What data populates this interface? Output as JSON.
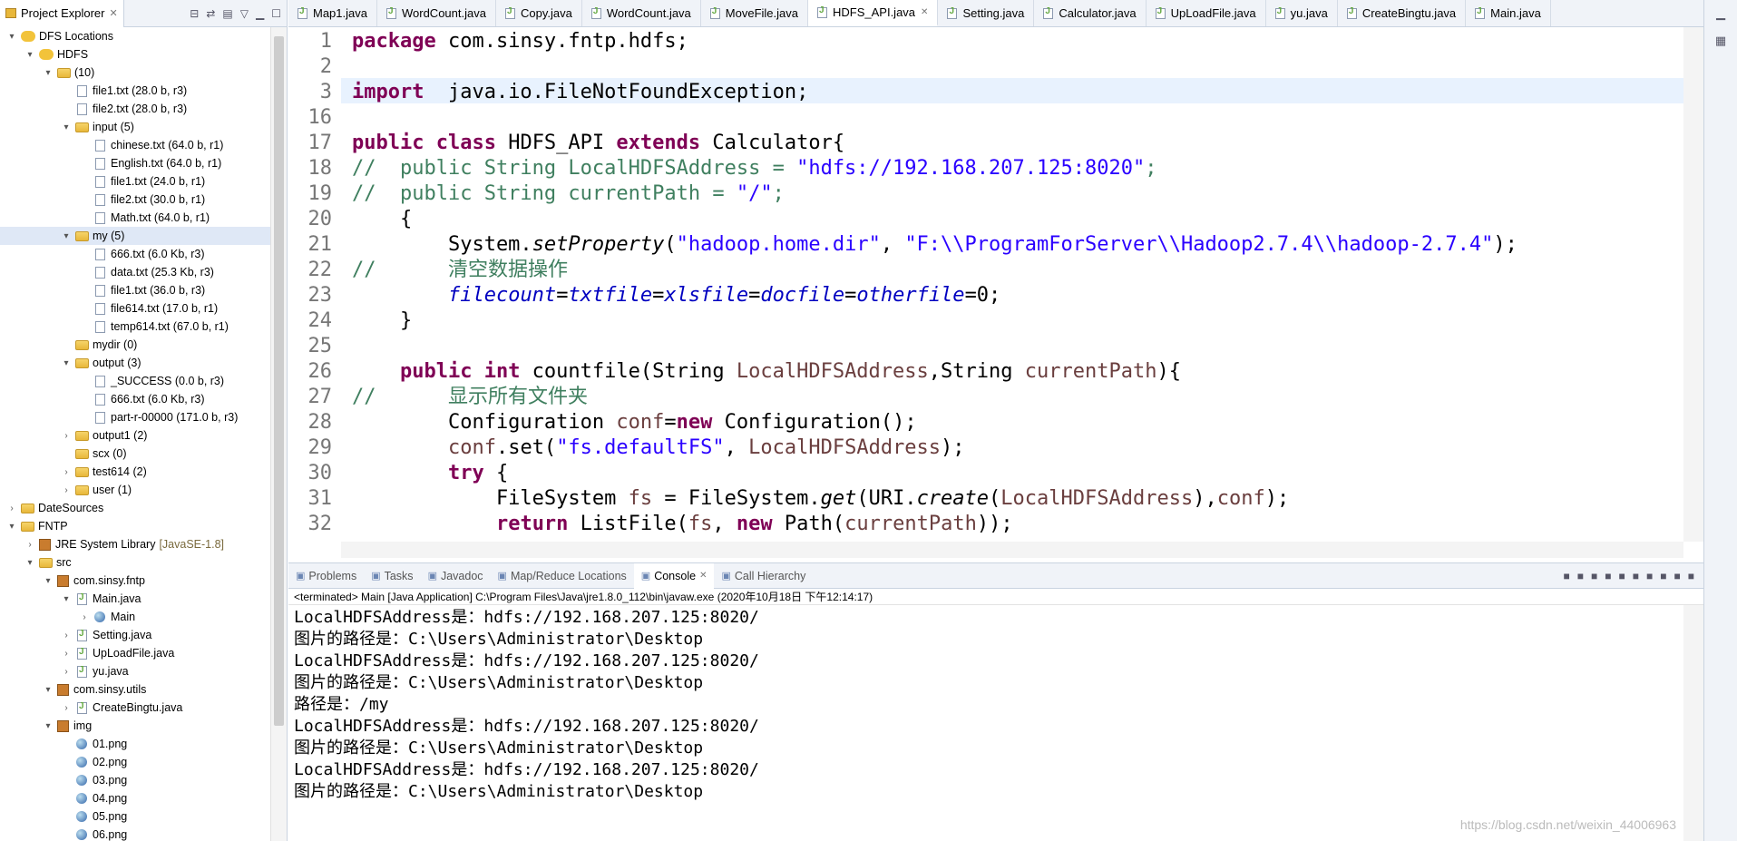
{
  "project_explorer": {
    "title": "Project Explorer",
    "tree": [
      {
        "indent": 0,
        "twisty": "▾",
        "icon": "hdfs",
        "label": "DFS Locations",
        "meta": ""
      },
      {
        "indent": 1,
        "twisty": "▾",
        "icon": "hdfs",
        "label": "HDFS",
        "meta": ""
      },
      {
        "indent": 2,
        "twisty": "▾",
        "icon": "folder",
        "label": "(10)",
        "meta": ""
      },
      {
        "indent": 3,
        "twisty": "",
        "icon": "file",
        "label": "file1.txt (28.0 b, r3)",
        "meta": ""
      },
      {
        "indent": 3,
        "twisty": "",
        "icon": "file",
        "label": "file2.txt (28.0 b, r3)",
        "meta": ""
      },
      {
        "indent": 3,
        "twisty": "▾",
        "icon": "folder",
        "label": "input (5)",
        "meta": ""
      },
      {
        "indent": 4,
        "twisty": "",
        "icon": "file",
        "label": "chinese.txt (64.0 b, r1)",
        "meta": ""
      },
      {
        "indent": 4,
        "twisty": "",
        "icon": "file",
        "label": "English.txt (64.0 b, r1)",
        "meta": ""
      },
      {
        "indent": 4,
        "twisty": "",
        "icon": "file",
        "label": "file1.txt (24.0 b, r1)",
        "meta": ""
      },
      {
        "indent": 4,
        "twisty": "",
        "icon": "file",
        "label": "file2.txt (30.0 b, r1)",
        "meta": ""
      },
      {
        "indent": 4,
        "twisty": "",
        "icon": "file",
        "label": "Math.txt (64.0 b, r1)",
        "meta": ""
      },
      {
        "indent": 3,
        "twisty": "▾",
        "icon": "folder",
        "label": "my (5)",
        "meta": "",
        "selected": true
      },
      {
        "indent": 4,
        "twisty": "",
        "icon": "file",
        "label": "666.txt (6.0 Kb, r3)",
        "meta": ""
      },
      {
        "indent": 4,
        "twisty": "",
        "icon": "file",
        "label": "data.txt (25.3 Kb, r3)",
        "meta": ""
      },
      {
        "indent": 4,
        "twisty": "",
        "icon": "file",
        "label": "file1.txt (36.0 b, r3)",
        "meta": ""
      },
      {
        "indent": 4,
        "twisty": "",
        "icon": "file",
        "label": "file614.txt (17.0 b, r1)",
        "meta": ""
      },
      {
        "indent": 4,
        "twisty": "",
        "icon": "file",
        "label": "temp614.txt (67.0 b, r1)",
        "meta": ""
      },
      {
        "indent": 3,
        "twisty": "",
        "icon": "folder",
        "label": "mydir (0)",
        "meta": ""
      },
      {
        "indent": 3,
        "twisty": "▾",
        "icon": "folder",
        "label": "output (3)",
        "meta": ""
      },
      {
        "indent": 4,
        "twisty": "",
        "icon": "file",
        "label": "_SUCCESS (0.0 b, r3)",
        "meta": ""
      },
      {
        "indent": 4,
        "twisty": "",
        "icon": "file",
        "label": "666.txt (6.0 Kb, r3)",
        "meta": ""
      },
      {
        "indent": 4,
        "twisty": "",
        "icon": "file",
        "label": "part-r-00000 (171.0 b, r3)",
        "meta": ""
      },
      {
        "indent": 3,
        "twisty": "›",
        "icon": "folder",
        "label": "output1 (2)",
        "meta": ""
      },
      {
        "indent": 3,
        "twisty": "",
        "icon": "folder",
        "label": "scx (0)",
        "meta": ""
      },
      {
        "indent": 3,
        "twisty": "›",
        "icon": "folder",
        "label": "test614 (2)",
        "meta": ""
      },
      {
        "indent": 3,
        "twisty": "›",
        "icon": "folder",
        "label": "user (1)",
        "meta": ""
      },
      {
        "indent": 0,
        "twisty": "›",
        "icon": "folder",
        "label": "DateSources",
        "meta": ""
      },
      {
        "indent": 0,
        "twisty": "▾",
        "icon": "folder",
        "label": "FNTP",
        "meta": ""
      },
      {
        "indent": 1,
        "twisty": "›",
        "icon": "pkg",
        "label": "JRE System Library",
        "meta": "[JavaSE-1.8]"
      },
      {
        "indent": 1,
        "twisty": "▾",
        "icon": "folder",
        "label": "src",
        "meta": ""
      },
      {
        "indent": 2,
        "twisty": "▾",
        "icon": "pkg",
        "label": "com.sinsy.fntp",
        "meta": ""
      },
      {
        "indent": 3,
        "twisty": "▾",
        "icon": "jfile",
        "label": "Main.java",
        "meta": ""
      },
      {
        "indent": 4,
        "twisty": "›",
        "icon": "img",
        "label": "Main",
        "meta": ""
      },
      {
        "indent": 3,
        "twisty": "›",
        "icon": "jfile",
        "label": "Setting.java",
        "meta": ""
      },
      {
        "indent": 3,
        "twisty": "›",
        "icon": "jfile",
        "label": "UpLoadFile.java",
        "meta": ""
      },
      {
        "indent": 3,
        "twisty": "›",
        "icon": "jfile",
        "label": "yu.java",
        "meta": ""
      },
      {
        "indent": 2,
        "twisty": "▾",
        "icon": "pkg",
        "label": "com.sinsy.utils",
        "meta": ""
      },
      {
        "indent": 3,
        "twisty": "›",
        "icon": "jfile",
        "label": "CreateBingtu.java",
        "meta": ""
      },
      {
        "indent": 2,
        "twisty": "▾",
        "icon": "pkg",
        "label": "img",
        "meta": ""
      },
      {
        "indent": 3,
        "twisty": "",
        "icon": "img",
        "label": "01.png",
        "meta": ""
      },
      {
        "indent": 3,
        "twisty": "",
        "icon": "img",
        "label": "02.png",
        "meta": ""
      },
      {
        "indent": 3,
        "twisty": "",
        "icon": "img",
        "label": "03.png",
        "meta": ""
      },
      {
        "indent": 3,
        "twisty": "",
        "icon": "img",
        "label": "04.png",
        "meta": ""
      },
      {
        "indent": 3,
        "twisty": "",
        "icon": "img",
        "label": "05.png",
        "meta": ""
      },
      {
        "indent": 3,
        "twisty": "",
        "icon": "img",
        "label": "06.png",
        "meta": ""
      }
    ]
  },
  "editor": {
    "tabs": [
      "Map1.java",
      "WordCount.java",
      "Copy.java",
      "WordCount.java",
      "MoveFile.java",
      "HDFS_API.java",
      "Setting.java",
      "Calculator.java",
      "UpLoadFile.java",
      "yu.java",
      "CreateBingtu.java",
      "Main.java"
    ],
    "active_tab": 5,
    "lines": [
      {
        "n": "1",
        "segs": [
          [
            "kw",
            "package"
          ],
          [
            "",
            "com.sinsy.fntp.hdfs;"
          ]
        ]
      },
      {
        "n": "2",
        "segs": []
      },
      {
        "n": "3",
        "segs": [
          [
            "kw",
            "import"
          ],
          [
            "",
            " java.io.FileNotFoundException;"
          ]
        ],
        "current": true
      },
      {
        "n": "16",
        "segs": []
      },
      {
        "n": "17",
        "segs": [
          [
            "kw",
            "public class"
          ],
          [
            "",
            " HDFS_API "
          ],
          [
            "kw",
            "extends"
          ],
          [
            "",
            " Calculator{"
          ]
        ]
      },
      {
        "n": "18",
        "segs": [
          [
            "cm",
            "//  public String LocalHDFSAddress = "
          ],
          [
            "st",
            "\"hdfs://192.168.207.125:8020\""
          ],
          [
            "cm",
            ";"
          ]
        ]
      },
      {
        "n": "19",
        "segs": [
          [
            "cm",
            "//  public String currentPath = "
          ],
          [
            "st",
            "\"/\""
          ],
          [
            "cm",
            ";"
          ]
        ]
      },
      {
        "n": "20",
        "segs": [
          [
            "",
            "    {"
          ]
        ]
      },
      {
        "n": "21",
        "segs": [
          [
            "",
            "        System."
          ],
          [
            "it",
            "setProperty"
          ],
          [
            "",
            "("
          ],
          [
            "st",
            "\"hadoop.home.dir\""
          ],
          [
            ", "
          ],
          [
            "st",
            "\"F:\\\\ProgramForServer\\\\Hadoop2.7.4\\\\hadoop-2.7.4\""
          ],
          [
            "",
            ");"
          ]
        ]
      },
      {
        "n": "22",
        "segs": [
          [
            "cm",
            "//      清空数据操作"
          ]
        ]
      },
      {
        "n": "23",
        "segs": [
          [
            "",
            "        "
          ],
          [
            "fi",
            "filecount"
          ],
          [
            "",
            "="
          ],
          [
            "fi",
            "txtfile"
          ],
          [
            "",
            "="
          ],
          [
            "fi",
            "xlsfile"
          ],
          [
            "",
            "="
          ],
          [
            "fi",
            "docfile"
          ],
          [
            "",
            "="
          ],
          [
            "fi",
            "otherfile"
          ],
          [
            "",
            "=0;"
          ]
        ]
      },
      {
        "n": "24",
        "segs": [
          [
            "",
            "    }"
          ]
        ]
      },
      {
        "n": "25",
        "segs": []
      },
      {
        "n": "26",
        "segs": [
          [
            "",
            "    "
          ],
          [
            "kw",
            "public int"
          ],
          [
            "",
            " countfile(String "
          ],
          [
            "lv",
            "LocalHDFSAddress"
          ],
          [
            "",
            ",String "
          ],
          [
            "lv",
            "currentPath"
          ],
          [
            "",
            "){"
          ]
        ]
      },
      {
        "n": "27",
        "segs": [
          [
            "cm",
            "//      显示所有文件夹"
          ]
        ]
      },
      {
        "n": "28",
        "segs": [
          [
            "",
            "        Configuration "
          ],
          [
            "lv",
            "conf"
          ],
          [
            "",
            "="
          ],
          [
            "kw",
            "new"
          ],
          [
            "",
            " Configuration();"
          ]
        ]
      },
      {
        "n": "29",
        "segs": [
          [
            "",
            "        "
          ],
          [
            "lv",
            "conf"
          ],
          [
            "",
            ".set("
          ],
          [
            "st",
            "\"fs.defaultFS\""
          ],
          [
            "",
            ", "
          ],
          [
            "lv",
            "LocalHDFSAddress"
          ],
          [
            "",
            ");"
          ]
        ]
      },
      {
        "n": "30",
        "segs": [
          [
            "",
            "        "
          ],
          [
            "kw",
            "try"
          ],
          [
            "",
            " {"
          ]
        ]
      },
      {
        "n": "31",
        "segs": [
          [
            "",
            "            FileSystem "
          ],
          [
            "lv",
            "fs"
          ],
          [
            "",
            " = FileSystem."
          ],
          [
            "it",
            "get"
          ],
          [
            "",
            "(URI."
          ],
          [
            "it",
            "create"
          ],
          [
            "",
            "("
          ],
          [
            "lv",
            "LocalHDFSAddress"
          ],
          [
            "",
            "),"
          ],
          [
            "lv",
            "conf"
          ],
          [
            "",
            ");"
          ]
        ]
      },
      {
        "n": "32",
        "segs": [
          [
            "",
            "            "
          ],
          [
            "kw",
            "return"
          ],
          [
            "",
            " ListFile("
          ],
          [
            "lv",
            "fs"
          ],
          [
            "",
            ", "
          ],
          [
            "kw",
            "new"
          ],
          [
            "",
            " Path("
          ],
          [
            "lv",
            "currentPath"
          ],
          [
            "",
            "));"
          ]
        ]
      }
    ]
  },
  "console": {
    "tabs": [
      "Problems",
      "Tasks",
      "Javadoc",
      "Map/Reduce Locations",
      "Console",
      "Call Hierarchy"
    ],
    "active_tab": 4,
    "status": "<terminated> Main [Java Application] C:\\Program Files\\Java\\jre1.8.0_112\\bin\\javaw.exe (2020年10月18日 下午12:14:17)",
    "lines": [
      "LocalHDFSAddress是：hdfs://192.168.207.125:8020/",
      "图片的路径是：C:\\Users\\Administrator\\Desktop",
      "LocalHDFSAddress是：hdfs://192.168.207.125:8020/",
      "图片的路径是：C:\\Users\\Administrator\\Desktop",
      "路径是：/my",
      "LocalHDFSAddress是：hdfs://192.168.207.125:8020/",
      "图片的路径是：C:\\Users\\Administrator\\Desktop",
      "LocalHDFSAddress是：hdfs://192.168.207.125:8020/",
      "图片的路径是：C:\\Users\\Administrator\\Desktop"
    ],
    "watermark": "https://blog.csdn.net/weixin_44006963"
  }
}
